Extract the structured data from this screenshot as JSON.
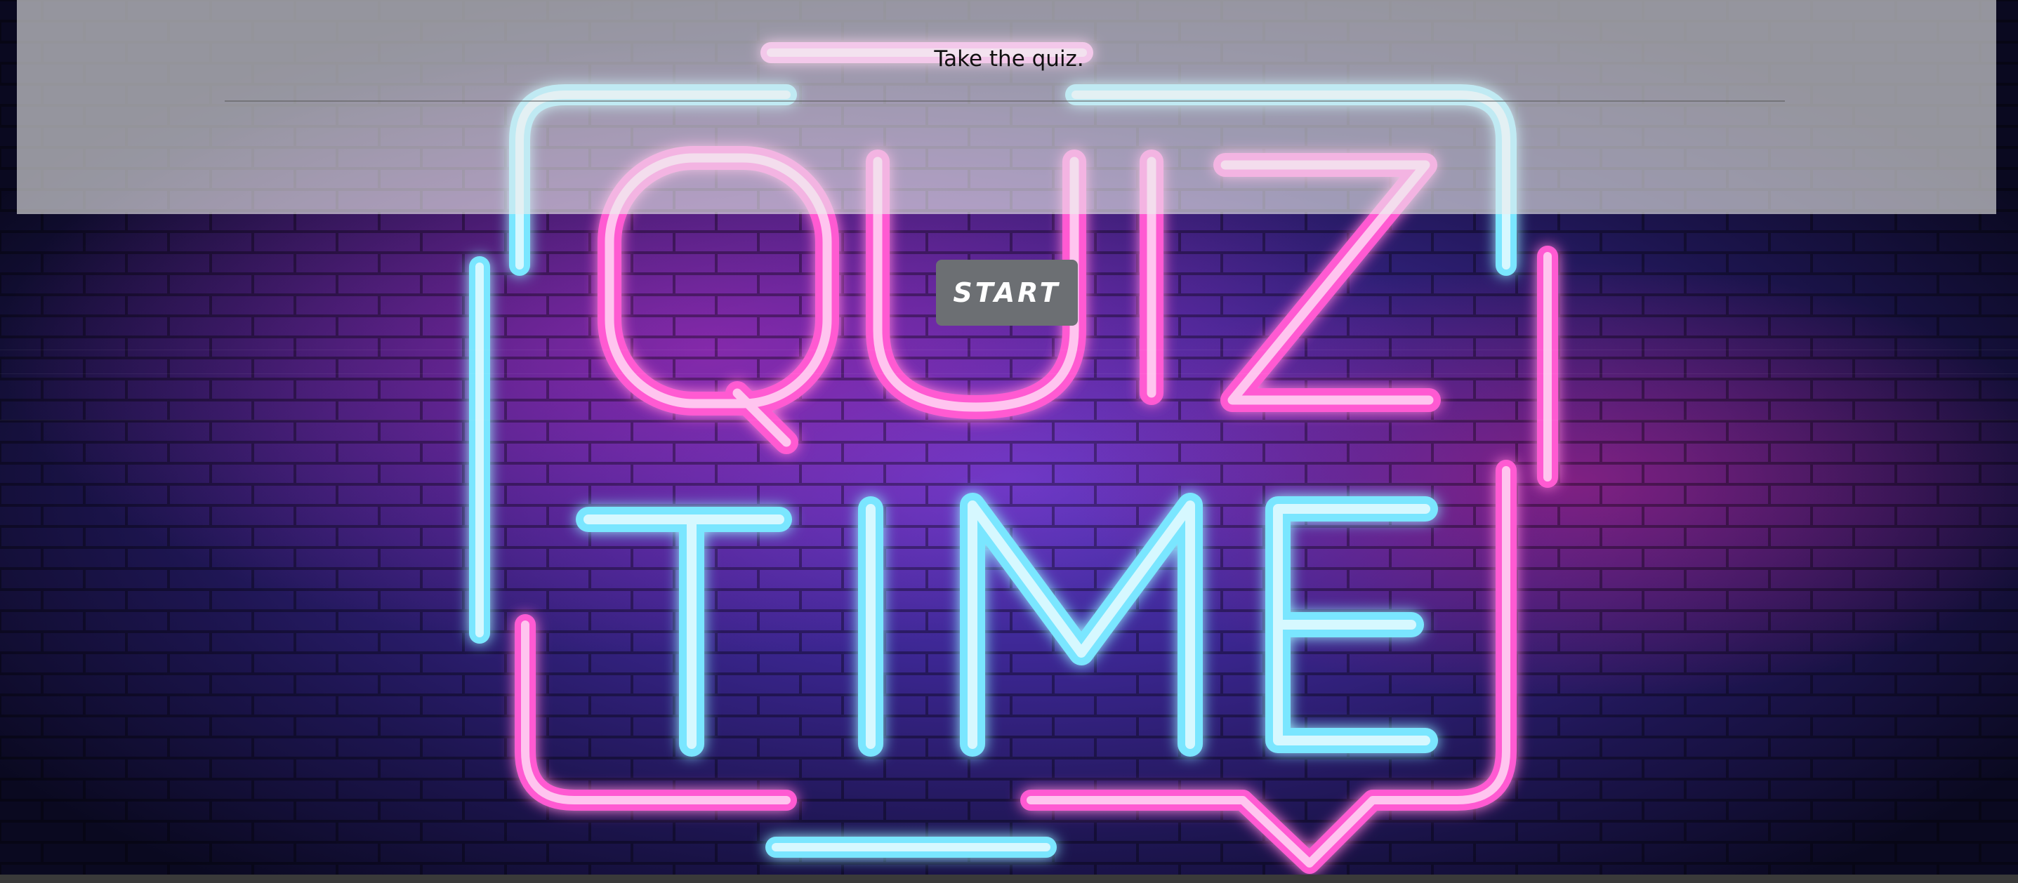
{
  "header": {
    "title": "Take the quiz."
  },
  "start_button": {
    "label": "START"
  },
  "hero_image": {
    "description_lines": [
      "QUIZ",
      "TIME"
    ],
    "colors": {
      "pink": "#ff5ad2",
      "cyan": "#7ae6ff",
      "wall_dark": "#141033",
      "wall_glow": "#4a2aa8"
    }
  }
}
